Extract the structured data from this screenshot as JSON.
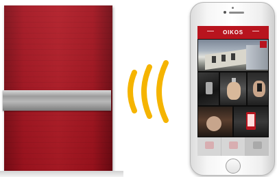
{
  "door": {
    "panel_text": "",
    "colors": {
      "panel": "#a3131f",
      "bar": "#9c9c9c"
    }
  },
  "signal": {
    "icon": "wireless-signal-icon",
    "arc_count": 3,
    "color": "#f5b400"
  },
  "phone": {
    "app": {
      "title": "OIKOS",
      "accent_color": "#b8141e"
    },
    "bottom_bar": [
      {
        "icon": "gear-icon",
        "label": ""
      },
      {
        "icon": "lock-icon",
        "label": ""
      },
      {
        "icon": "menu-icon",
        "label": ""
      }
    ]
  }
}
